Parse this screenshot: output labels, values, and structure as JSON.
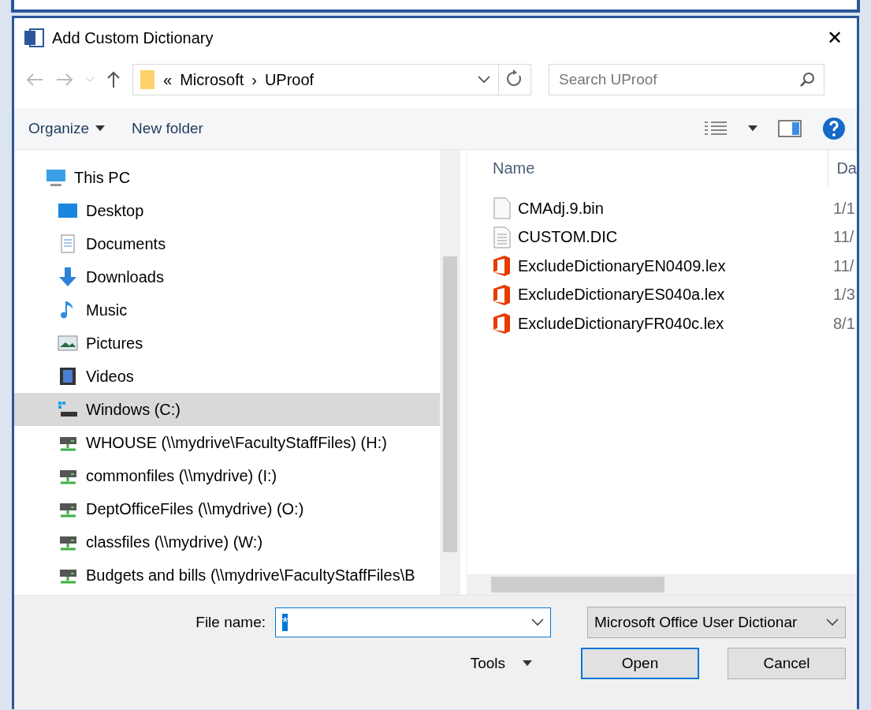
{
  "window": {
    "title": "Add Custom Dictionary",
    "close": "✕"
  },
  "address": {
    "crumbs": [
      "«",
      "Microsoft",
      "›",
      "UProof"
    ],
    "search_placeholder": "Search UProof"
  },
  "toolbar": {
    "organize": "Organize",
    "new_folder": "New folder"
  },
  "sidebar": {
    "items": [
      {
        "label": "This PC",
        "kind": "computer",
        "selected": false,
        "children": [
          {
            "label": "Desktop",
            "kind": "desktop",
            "selected": false
          },
          {
            "label": "Documents",
            "kind": "documents",
            "selected": false
          },
          {
            "label": "Downloads",
            "kind": "downloads",
            "selected": false
          },
          {
            "label": "Music",
            "kind": "music",
            "selected": false
          },
          {
            "label": "Pictures",
            "kind": "pictures",
            "selected": false
          },
          {
            "label": "Videos",
            "kind": "videos",
            "selected": false
          },
          {
            "label": "Windows (C:)",
            "kind": "system-drive",
            "selected": true
          },
          {
            "label": "WHOUSE (\\\\mydrive\\FacultyStaffFiles) (H:)",
            "kind": "network-drive",
            "selected": false
          },
          {
            "label": "commonfiles (\\\\mydrive) (I:)",
            "kind": "network-drive",
            "selected": false
          },
          {
            "label": "DeptOfficeFiles (\\\\mydrive) (O:)",
            "kind": "network-drive",
            "selected": false
          },
          {
            "label": "classfiles (\\\\mydrive) (W:)",
            "kind": "network-drive",
            "selected": false
          },
          {
            "label": "Budgets and bills (\\\\mydrive\\FacultyStaffFiles\\B",
            "kind": "network-drive",
            "selected": false
          }
        ]
      }
    ]
  },
  "file_list": {
    "columns": [
      "Name",
      "Da"
    ],
    "rows": [
      {
        "name": "CMAdj.9.bin",
        "kind": "blank",
        "date": "1/1"
      },
      {
        "name": "CUSTOM.DIC",
        "kind": "text",
        "date": "11/"
      },
      {
        "name": "ExcludeDictionaryEN0409.lex",
        "kind": "office",
        "date": "11/"
      },
      {
        "name": "ExcludeDictionaryES040a.lex",
        "kind": "office",
        "date": "1/3"
      },
      {
        "name": "ExcludeDictionaryFR040c.lex",
        "kind": "office",
        "date": "8/1"
      }
    ]
  },
  "footer": {
    "file_name_label": "File name:",
    "file_name_value": "*",
    "file_type": "Microsoft Office User Dictionar",
    "tools": "Tools",
    "buttons": [
      {
        "label": "Open",
        "kind": "default"
      },
      {
        "label": "Cancel",
        "kind": "normal"
      }
    ]
  }
}
